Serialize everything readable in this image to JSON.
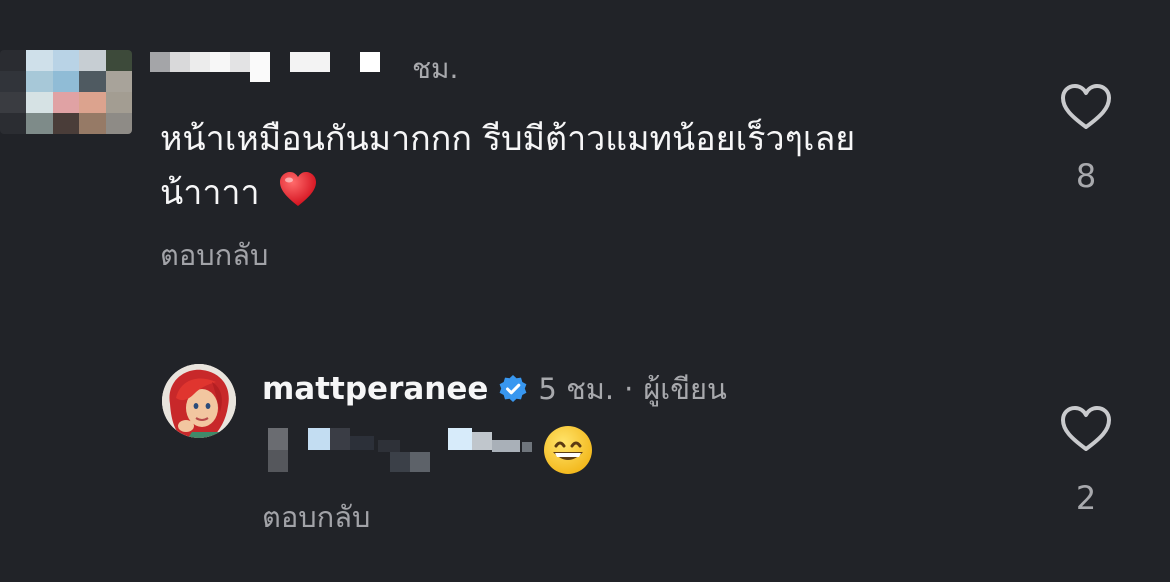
{
  "comments": [
    {
      "author_redacted": true,
      "time": "ชม.",
      "text_line1": "หน้าเหมือนกันมากกก รีบมีต้าวแมทน้อยเร็วๆเลย",
      "text_line2": "น้าาาา",
      "emoji": "heart-emoji",
      "reply_label": "ตอบกลับ",
      "like_count": "8",
      "like_icon": "heart-outline-icon"
    },
    {
      "username": "mattperanee",
      "verified": true,
      "time": "5 ชม.",
      "separator": "·",
      "author_tag": "ผู้เขียน",
      "text_redacted": true,
      "emoji": "grinning-face-emoji",
      "reply_label": "ตอบกลับ",
      "like_count": "2",
      "like_icon": "heart-outline-icon"
    }
  ],
  "colors": {
    "background": "#212328",
    "text_primary": "#f6f6f7",
    "text_secondary": "#a8a9ad",
    "verified_badge": "#3897f0"
  }
}
